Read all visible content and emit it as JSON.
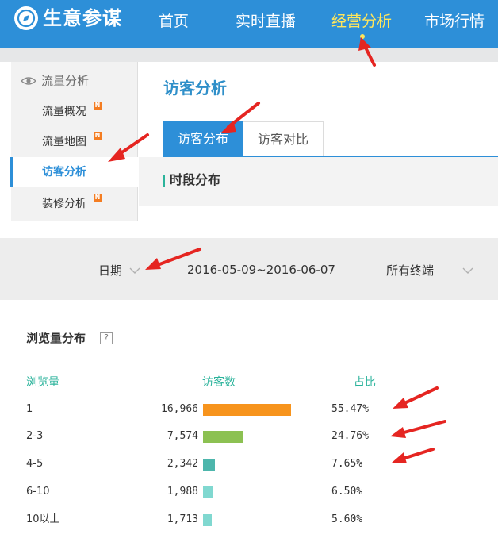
{
  "app": {
    "brand": "生意参谋"
  },
  "nav": {
    "items": [
      "首页",
      "实时直播",
      "经营分析",
      "市场行情"
    ],
    "active_index": 2
  },
  "sidebar": {
    "header": "流量分析",
    "items": [
      {
        "label": "流量概况",
        "badge": "N"
      },
      {
        "label": "流量地图",
        "badge": "N"
      },
      {
        "label": "访客分析",
        "badge": ""
      },
      {
        "label": "装修分析",
        "badge": "N"
      }
    ],
    "active_index": 2
  },
  "main": {
    "title": "访客分析",
    "tabs": [
      "访客分布",
      "访客对比"
    ],
    "active_tab": 0,
    "section_title": "时段分布"
  },
  "filters": {
    "date_label": "日期",
    "date_range": "2016-05-09~2016-06-07",
    "device": "所有终端"
  },
  "pageview_distribution": {
    "title": "浏览量分布",
    "help": "?",
    "columns": [
      "浏览量",
      "访客数",
      "占比"
    ],
    "rows": [
      {
        "range": "1",
        "visitors": "16,966",
        "share": "55.47%",
        "share_value": 55.47,
        "bar_color": "#f7941d"
      },
      {
        "range": "2-3",
        "visitors": "7,574",
        "share": "24.76%",
        "share_value": 24.76,
        "bar_color": "#8cc152"
      },
      {
        "range": "4-5",
        "visitors": "2,342",
        "share": "7.65%",
        "share_value": 7.65,
        "bar_color": "#4db6ac"
      },
      {
        "range": "6-10",
        "visitors": "1,988",
        "share": "6.50%",
        "share_value": 6.5,
        "bar_color": "#80d8d0"
      },
      {
        "range": "10以上",
        "visitors": "1,713",
        "share": "5.60%",
        "share_value": 5.6,
        "bar_color": "#80d8d0"
      }
    ]
  },
  "colors": {
    "brand_blue": "#2d8fd8",
    "active_nav": "#ffe65c",
    "accent_teal": "#2bb39b",
    "annotation_red": "#e52521"
  }
}
